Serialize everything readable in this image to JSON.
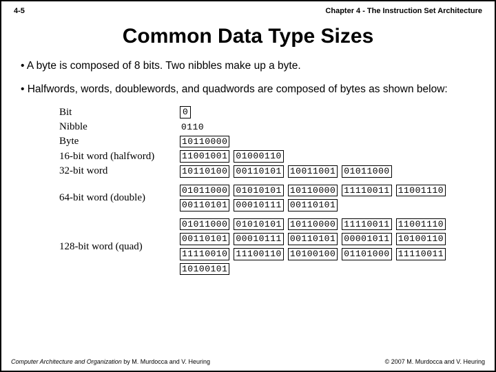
{
  "header": {
    "page_number": "4-5",
    "chapter": "Chapter 4 - The Instruction Set Architecture"
  },
  "title": "Common Data Type Sizes",
  "bullets": [
    "A byte is composed of 8 bits. Two nibbles make up a byte.",
    "Halfwords, words, doublewords, and quadwords are composed of bytes as shown below:"
  ],
  "rows": [
    {
      "label": "Bit",
      "cells": [
        "0"
      ],
      "boxed": true
    },
    {
      "label": "Nibble",
      "cells": [
        "0110"
      ],
      "boxed": false
    },
    {
      "label": "Byte",
      "cells": [
        "10110000"
      ],
      "boxed": true
    },
    {
      "label": "16-bit word (halfword)",
      "cells": [
        "11001001",
        "01000110"
      ],
      "boxed": true
    },
    {
      "label": "32-bit word",
      "cells": [
        "10110100",
        "00110101",
        "10011001",
        "01011000"
      ],
      "boxed": true
    },
    {
      "label": "64-bit word (double)",
      "cells": [
        "01011000",
        "01010101",
        "10110000",
        "11110011",
        "11001110",
        "00110101",
        "00010111",
        "00110101"
      ],
      "boxed": true
    },
    {
      "label": "128-bit word (quad)",
      "cells": [
        "01011000",
        "01010101",
        "10110000",
        "11110011",
        "11001110",
        "00110101",
        "00010111",
        "00110101",
        "00001011",
        "10100110",
        "11110010",
        "11100110",
        "10100100",
        "01101000",
        "11110011",
        "10100101"
      ],
      "boxed": true
    }
  ],
  "footer": {
    "left_title": "Computer Architecture and Organization",
    "left_authors": " by M. Murdocca and V. Heuring",
    "right": "© 2007 M. Murdocca and V. Heuring"
  }
}
